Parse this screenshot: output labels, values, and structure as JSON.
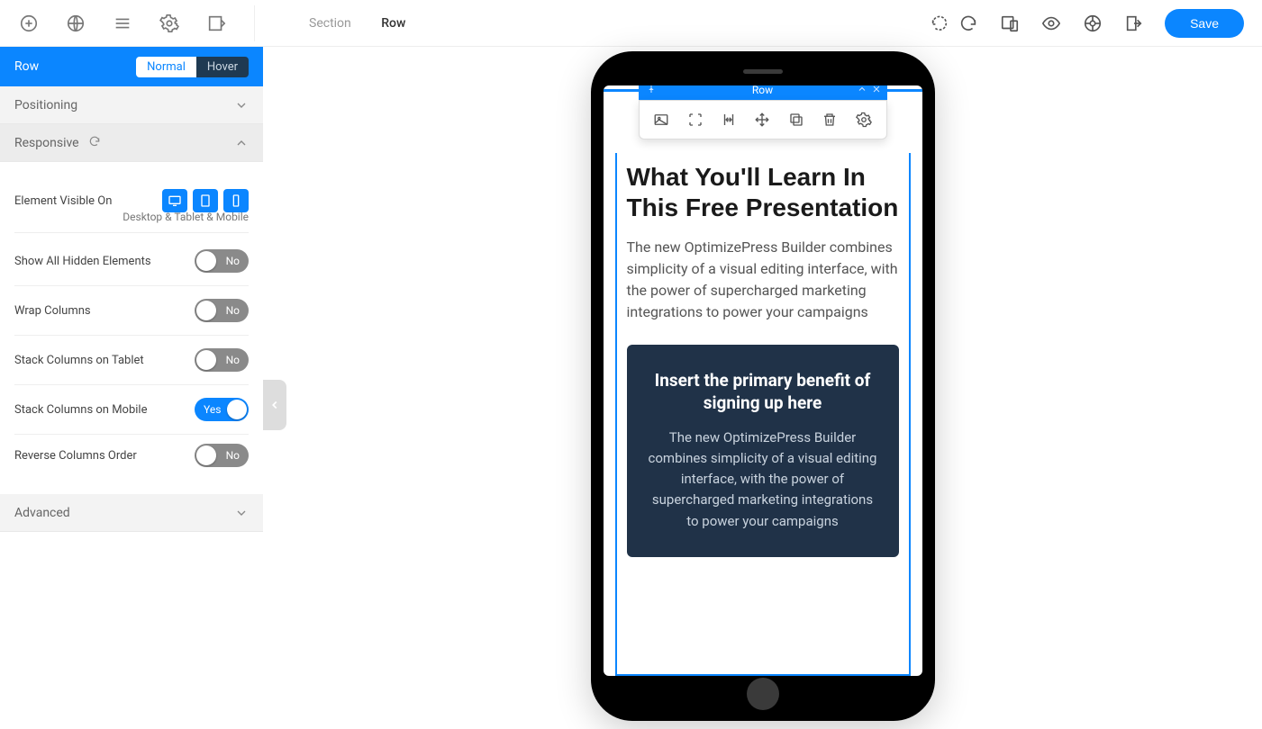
{
  "breadcrumb": {
    "parent": "Section",
    "current": "Row"
  },
  "save_label": "Save",
  "sidebar": {
    "title": "Row",
    "state_normal": "Normal",
    "state_hover": "Hover",
    "sections": {
      "positioning": "Positioning",
      "responsive": "Responsive",
      "advanced": "Advanced"
    },
    "visible_on_label": "Element Visible On",
    "visible_on_summary": "Desktop & Tablet & Mobile",
    "toggles": {
      "show_hidden": {
        "label": "Show All Hidden Elements",
        "state": "No"
      },
      "wrap_columns": {
        "label": "Wrap Columns",
        "state": "No"
      },
      "stack_tablet": {
        "label": "Stack Columns on Tablet",
        "state": "No"
      },
      "stack_mobile": {
        "label": "Stack Columns on Mobile",
        "state": "Yes"
      },
      "reverse_order": {
        "label": "Reverse Columns Order",
        "state": "No"
      }
    }
  },
  "row_toolbar_label": "Row",
  "content": {
    "heading": "What You'll Learn In This Free Presentation",
    "paragraph": "The new OptimizePress Builder combines simplicity of a visual editing interface, with the power of supercharged marketing integrations to power your campaigns",
    "card_heading": "Insert the primary benefit of signing up here",
    "card_paragraph": "The new OptimizePress Builder combines simplicity of a visual editing interface, with the power of supercharged marketing integrations to power your campaigns"
  }
}
